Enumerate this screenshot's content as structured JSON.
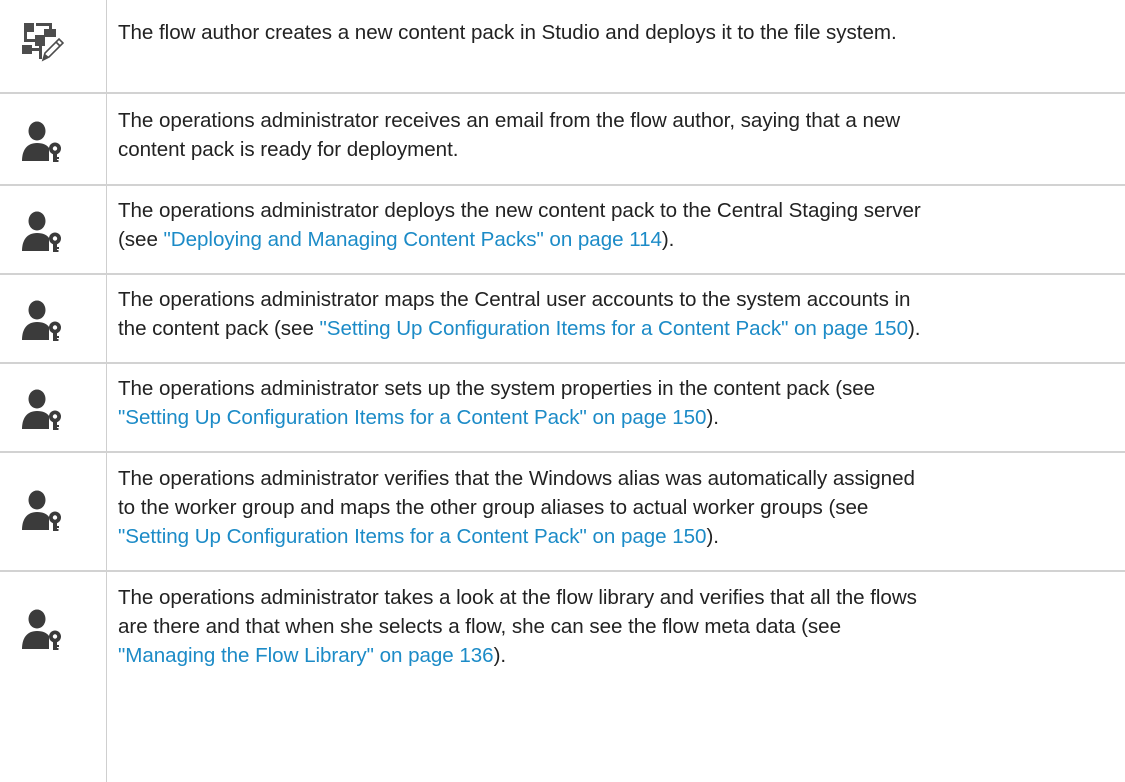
{
  "rows": [
    {
      "icon": "flow-author-icon",
      "lines": [
        {
          "text": "The flow author creates a new content pack in Studio and deploys it to the file system."
        }
      ]
    },
    {
      "icon": "operations-admin-icon",
      "lines": [
        {
          "text": "The operations administrator receives an email from the flow author, saying that a new"
        },
        {
          "text": "content pack is ready for deployment."
        }
      ]
    },
    {
      "icon": "operations-admin-icon",
      "lines": [
        {
          "text": "The operations administrator deploys the new content pack to the Central Staging server"
        },
        {
          "pre": "(see ",
          "link": "\"Deploying and Managing Content Packs\" on page 114",
          "post": ")."
        }
      ]
    },
    {
      "icon": "operations-admin-icon",
      "lines": [
        {
          "text": "The operations administrator maps the Central user accounts to the system accounts in"
        },
        {
          "pre": "the content pack (see ",
          "link": "\"Setting Up Configuration Items for a Content Pack\" on page 150",
          "post": ")."
        }
      ]
    },
    {
      "icon": "operations-admin-icon",
      "lines": [
        {
          "text": "The operations administrator sets up the system properties in the content pack (see"
        },
        {
          "pre": "",
          "link": "\"Setting Up Configuration Items for a Content Pack\" on page 150",
          "post": ")."
        }
      ]
    },
    {
      "icon": "operations-admin-icon",
      "lines": [
        {
          "text": "The operations administrator verifies that the Windows alias was automatically assigned"
        },
        {
          "text": "to the worker group and maps the other group aliases to actual worker groups (see"
        },
        {
          "pre": "",
          "link": "\"Setting Up Configuration Items for a Content Pack\" on page 150",
          "post": ")."
        }
      ]
    },
    {
      "icon": "operations-admin-icon",
      "lines": [
        {
          "text": "The operations administrator takes a look at the flow library and verifies that all the flows"
        },
        {
          "text": "are there and that when she selects a flow, she can see the flow meta data (see"
        },
        {
          "pre": "",
          "link": "\"Managing the Flow Library\" on page 136",
          "post": ")."
        }
      ]
    }
  ]
}
